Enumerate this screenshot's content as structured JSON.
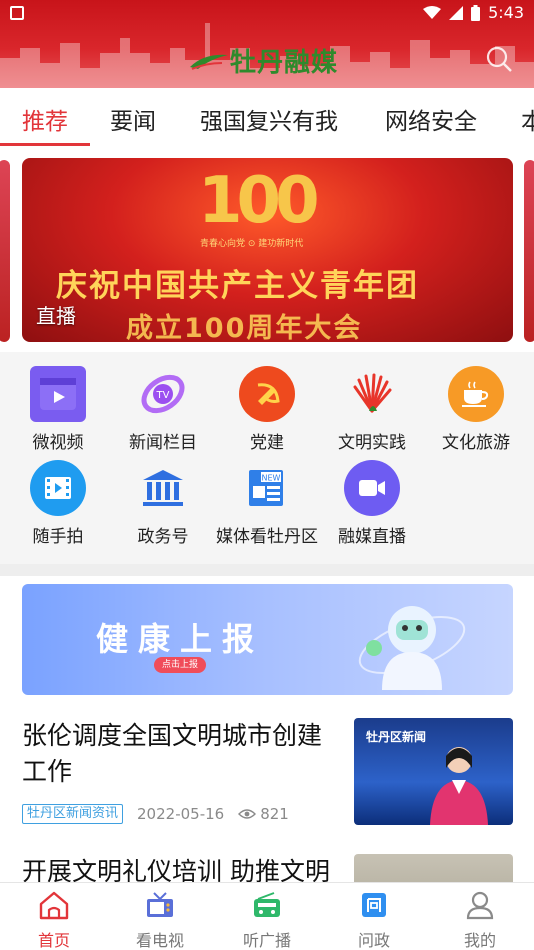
{
  "status_bar": {
    "time": "5:43"
  },
  "header": {
    "logo_text": "牡丹融媒"
  },
  "tabs": [
    {
      "label": "推荐",
      "active": true
    },
    {
      "label": "要闻"
    },
    {
      "label": "强国复兴有我"
    },
    {
      "label": "网络安全"
    },
    {
      "label": "本"
    }
  ],
  "banner": {
    "number": "100",
    "slogan": "青春心向党 ⊙ 建功新时代",
    "line1": "庆祝中国共产主义青年团",
    "line2": "成立100周年大会",
    "caption": "直播"
  },
  "shortcuts": [
    {
      "label": "微视频",
      "icon": "video-clip-icon"
    },
    {
      "label": "新闻栏目",
      "icon": "tv-column-icon"
    },
    {
      "label": "党建",
      "icon": "hammer-sickle-icon"
    },
    {
      "label": "文明实践",
      "icon": "fan-leaf-icon"
    },
    {
      "label": "文化旅游",
      "icon": "coffee-cup-icon"
    },
    {
      "label": "随手拍",
      "icon": "film-icon"
    },
    {
      "label": "政务号",
      "icon": "government-building-icon"
    },
    {
      "label": "媒体看牡丹区",
      "icon": "newspaper-icon"
    },
    {
      "label": "融媒直播",
      "icon": "live-camera-icon"
    }
  ],
  "ad": {
    "title": "健康上报",
    "button": "点击上报"
  },
  "news": [
    {
      "title": "张伦调度全国文明城市创建工作",
      "tag": "牡丹区新闻资讯",
      "date": "2022-05-16",
      "views": "821",
      "thumb_brand": "牡丹区新闻"
    },
    {
      "title": "开展文明礼仪培训 助推文明"
    }
  ],
  "bottom_nav": [
    {
      "label": "首页",
      "icon": "home-icon",
      "active": true
    },
    {
      "label": "看电视",
      "icon": "tv-icon"
    },
    {
      "label": "听广播",
      "icon": "radio-icon"
    },
    {
      "label": "问政",
      "icon": "inquiry-icon"
    },
    {
      "label": "我的",
      "icon": "user-icon"
    }
  ],
  "colors": {
    "brand_red": "#e2353a",
    "header_red": "#d9262b",
    "tag_blue": "#3fa0e0"
  }
}
